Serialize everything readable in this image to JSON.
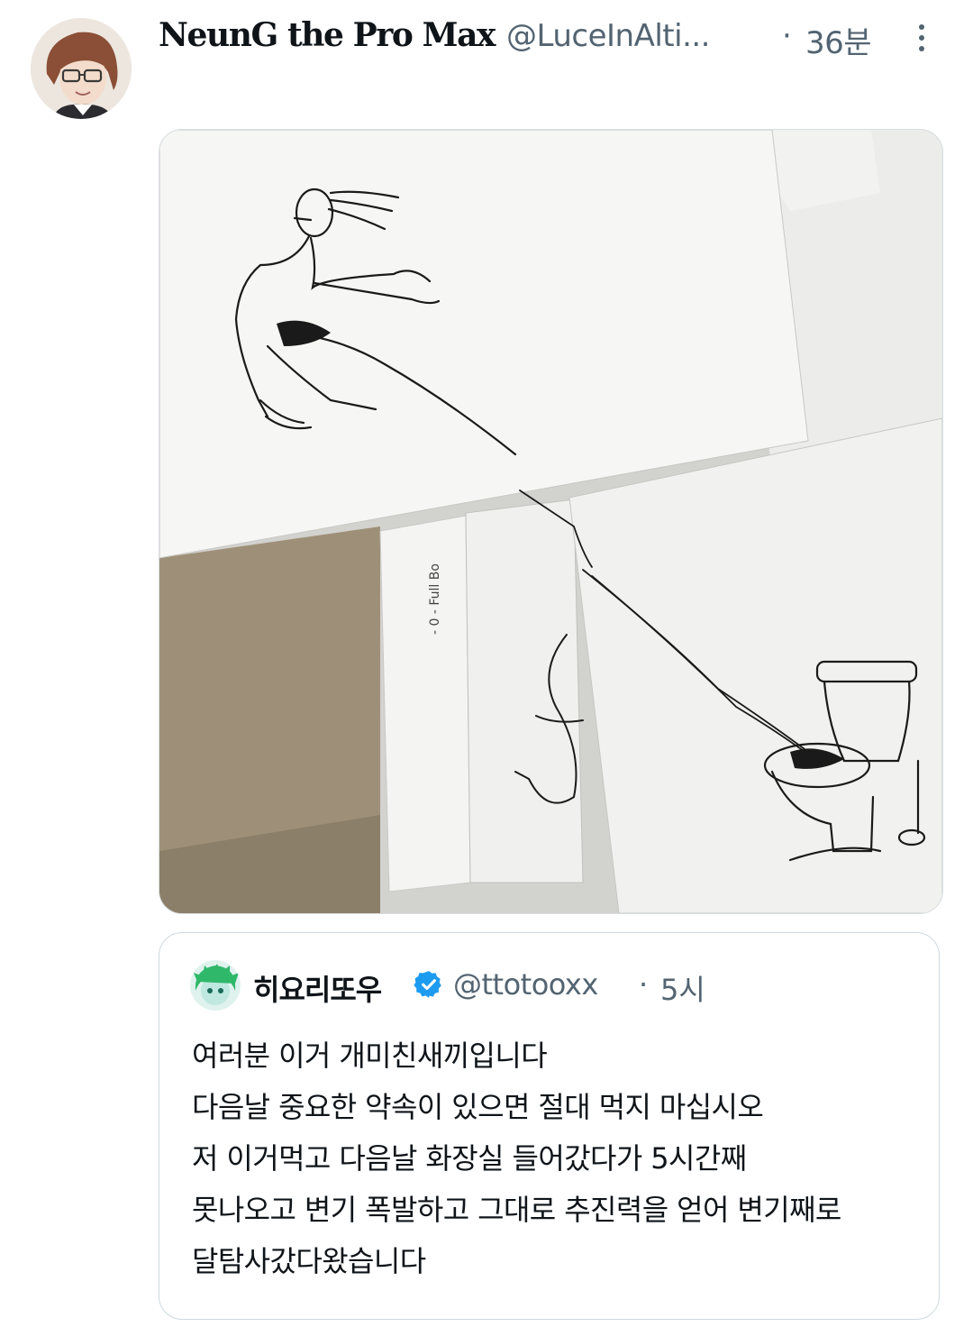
{
  "tweet": {
    "display_name": "NeunG the Pro Max",
    "handle": "@LuceInAlti...",
    "separator": "·",
    "time": "36분",
    "more_icon": "more-vertical-icon",
    "avatar": "avatar-illustration"
  },
  "media": {
    "image": "photo-of-drawings"
  },
  "quote": {
    "display_name": "히요리또우",
    "verified_icon": "verified-badge-icon",
    "handle": "@ttotooxx",
    "separator": "·",
    "time": "5시",
    "lines": [
      "여러분 이거 개미친새끼입니다",
      "다음날 중요한 약속이 있으면 절대 먹지 마십시오",
      "저 이거먹고 다음날 화장실 들어갔다가 5시간째",
      "못나오고 변기 폭발하고 그대로 추진력을 얻어 변기째로",
      "달탐사갔다왔습니다"
    ]
  },
  "colors": {
    "text_primary": "#0f1419",
    "text_secondary": "#536471",
    "border": "#cfd9de",
    "verified": "#1d9bf0"
  }
}
